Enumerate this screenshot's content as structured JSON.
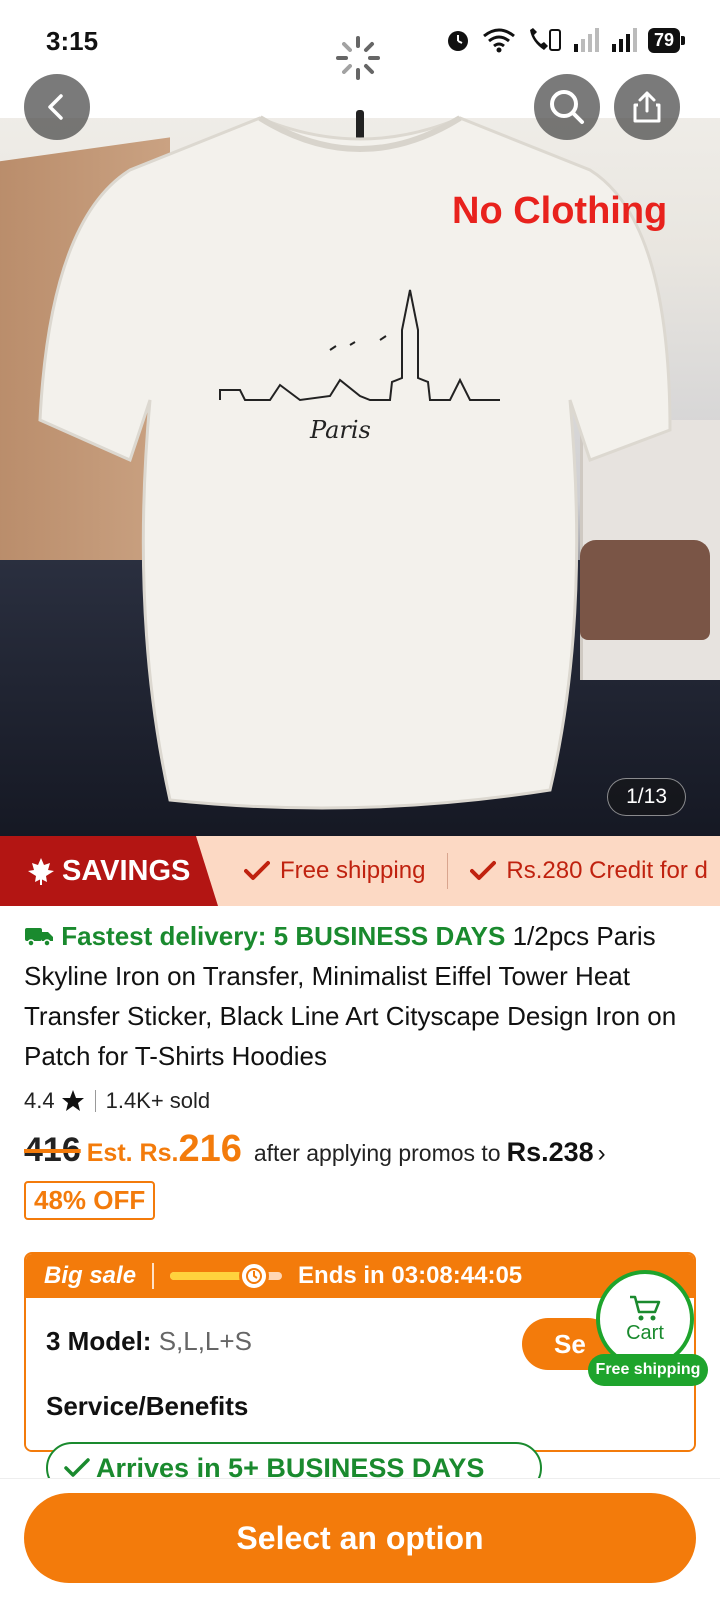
{
  "status_bar": {
    "time": "3:15",
    "battery": "79"
  },
  "gallery": {
    "watermark": "No Clothing",
    "counter": "1/13",
    "shirt_print": "Paris"
  },
  "savings": {
    "tag": "SAVINGS",
    "items": [
      "Free shipping",
      "Rs.280 Credit for d"
    ]
  },
  "product": {
    "fast_delivery": "Fastest delivery: 5 BUSINESS DAYS",
    "title": "1/2pcs Paris Skyline Iron on Transfer, Minimalist Eiffel Tower Heat Transfer Sticker, Black Line Art Cityscape Design Iron on Patch for T-Shirts Hoodies",
    "rating": "4.4",
    "sold": "1.4K+ sold",
    "old_price": "416",
    "est_prefix": "Est. Rs.",
    "est_price": "216",
    "after_text": "after applying promos to",
    "final_price": "Rs.238",
    "discount": "48% OFF"
  },
  "sale": {
    "label": "Big sale",
    "ends_text": "Ends in 03:08:44:05",
    "progress": 0.75,
    "model_label": "3 Model:",
    "model_values": "S,L,L+S",
    "select_label": "Se",
    "service_label": "Service/Benefits",
    "arrives": "Arrives in 5+ BUSINESS DAYS"
  },
  "cart": {
    "label": "Cart",
    "shipping": "Free shipping"
  },
  "bottom": {
    "cta": "Select an option"
  },
  "colors": {
    "accent": "#f37b0b",
    "green": "#1a8a2e",
    "savings_red": "#b31513"
  }
}
